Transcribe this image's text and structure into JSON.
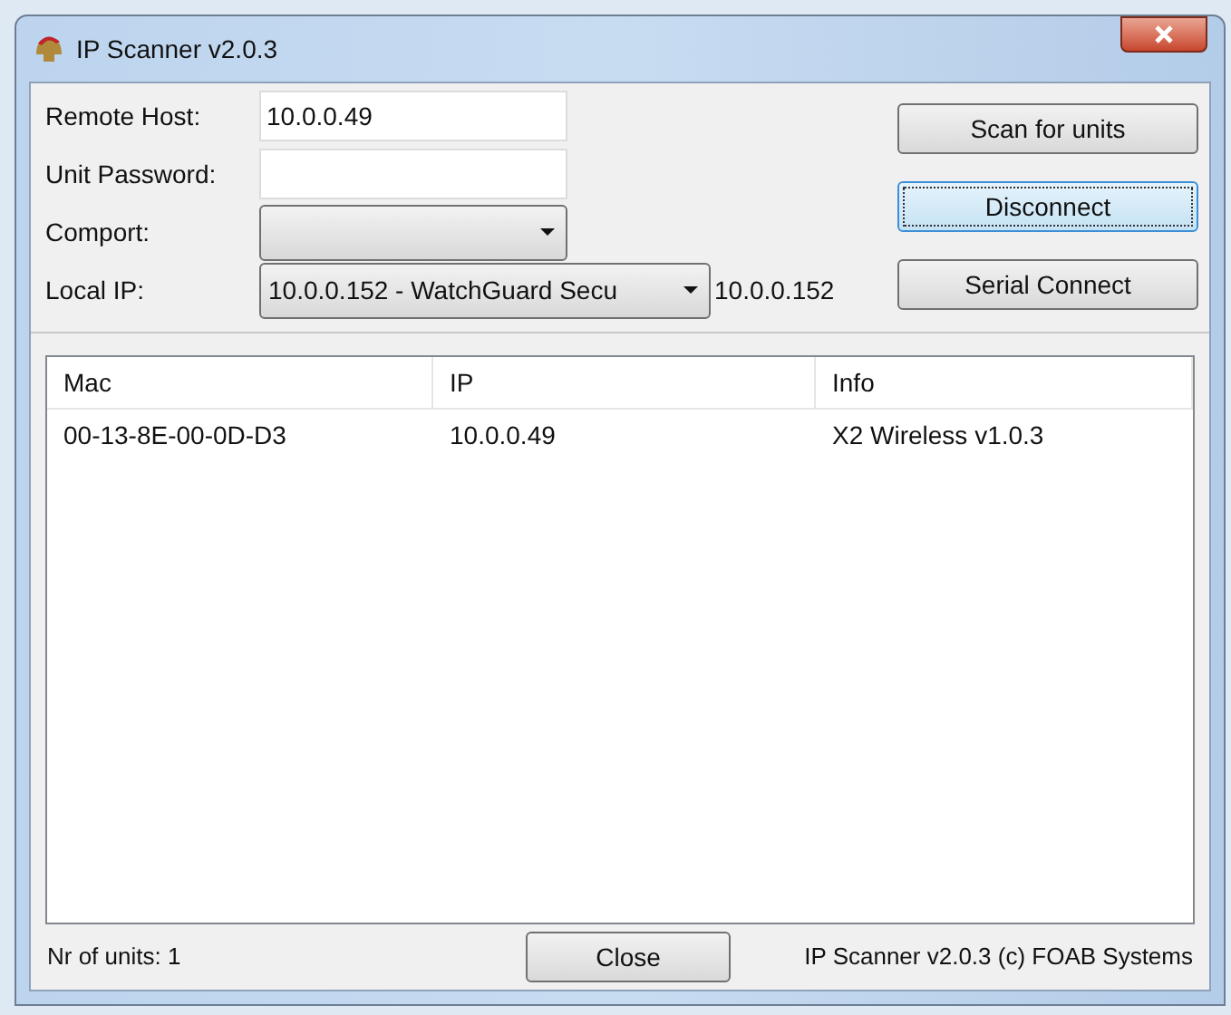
{
  "window": {
    "title": "IP Scanner v2.0.3"
  },
  "fields": [
    {
      "kind": "text",
      "label": "Remote Host:",
      "value": "10.0.0.49"
    },
    {
      "kind": "text",
      "label": "Unit Password:"
    },
    {
      "kind": "combo",
      "label": "Comport:"
    },
    {
      "kind": "combo",
      "label": "Local IP:",
      "value": "10.0.0.152 - WatchGuard Secu",
      "note": "10.0.0.152"
    }
  ],
  "buttons": [
    {
      "label": "Scan for units",
      "focused": false
    },
    {
      "label": "Disconnect",
      "focused": true
    },
    {
      "label": "Serial Connect",
      "focused": false
    }
  ],
  "table": {
    "columns": [
      "Mac",
      "IP",
      "Info"
    ],
    "rows": [
      [
        "00-13-8E-00-0D-D3",
        "10.0.0.49",
        "X2 Wireless v1.0.3"
      ]
    ]
  },
  "status_bar": {
    "count": "Nr of units: 1",
    "close_button": "Close",
    "copyright": "IP Scanner v2.0.3 (c) FOAB Systems"
  }
}
